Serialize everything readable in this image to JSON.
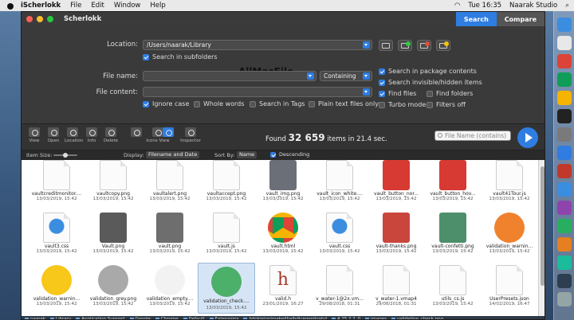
{
  "menubar": {
    "app": "iScherlokk",
    "menus": [
      "File",
      "Edit",
      "Window",
      "Help"
    ],
    "time": "Tue 16:35",
    "user": "Naarak Studio"
  },
  "window": {
    "title": "Scherlokk",
    "search_label": "Search",
    "compare_label": "Compare"
  },
  "form": {
    "location_label": "Location:",
    "location_value": "/Users/naarak/Library",
    "search_subfolders": "Search in subfolders",
    "filename_label": "File name:",
    "filename_mode": "Containing",
    "content_label": "File content:",
    "options": [
      {
        "label": "Ignore case",
        "checked": true
      },
      {
        "label": "Whole words",
        "checked": false
      },
      {
        "label": "Search in Tags",
        "checked": false
      },
      {
        "label": "Plain text files only",
        "checked": false
      }
    ],
    "right_options": [
      {
        "label": "Search in package contents",
        "checked": true
      },
      {
        "label": "Search invisible/hidden items",
        "checked": true
      },
      {
        "label": "Find files",
        "checked": true
      },
      {
        "label": "Find folders",
        "checked": false
      },
      {
        "label": "Turbo mode",
        "checked": false
      },
      {
        "label": "Filters off",
        "checked": false
      }
    ],
    "badges": [
      "1",
      "2",
      "3"
    ],
    "watermark": "AllMacFile"
  },
  "toolbar": {
    "tools": [
      "View",
      "Open",
      "Location",
      "Info",
      "Delete"
    ],
    "view_tools": [
      "Icons View",
      "Inspector"
    ],
    "found_prefix": "Found",
    "found_count": "32 659",
    "found_suffix": "items in 21.4 sec.",
    "filename_placeholder": "File Name (contains)"
  },
  "subbar": {
    "item_size": "Item Size:",
    "display_label": "Display:",
    "display_value": "Filename and Date",
    "sortby_label": "Sort By:",
    "sortby_value": "Name",
    "descending": "Descending"
  },
  "rows": [
    [
      {
        "name": "vaultcreditmonitor....",
        "date": "13/03/2019, 15:42",
        "kind": "doc",
        "color": "#ffffff"
      },
      {
        "name": "vaultcopy.png",
        "date": "13/03/2019, 15:42",
        "kind": "doc",
        "color": "#ffffff"
      },
      {
        "name": "vaultalert.png",
        "date": "13/03/2019, 15:42",
        "kind": "doc",
        "color": "#ffffff"
      },
      {
        "name": "vaultaccept.png",
        "date": "13/03/2019, 15:42",
        "kind": "doc",
        "color": "#ffffff"
      },
      {
        "name": "vault_img.png",
        "date": "13/03/2019, 15:42",
        "kind": "img",
        "color": "#6a6f78"
      },
      {
        "name": "vault_icon_white....",
        "date": "13/03/2019, 15:42",
        "kind": "doc",
        "color": "#ffffff"
      },
      {
        "name": "vault_button_nor...",
        "date": "13/03/2019, 15:42",
        "kind": "img",
        "color": "#d63a33"
      },
      {
        "name": "vault_button_hov...",
        "date": "13/03/2019, 15:42",
        "kind": "img",
        "color": "#d63a33"
      },
      {
        "name": "vault41Tour.js",
        "date": "13/03/2019, 15:42",
        "kind": "doc",
        "color": "#ffffff"
      }
    ],
    [
      {
        "name": "vault3.css",
        "date": "13/03/2019, 15:42",
        "kind": "css",
        "color": "#3b8de0"
      },
      {
        "name": "Vault.png",
        "date": "13/03/2019, 15:42",
        "kind": "img",
        "color": "#5a5a5a"
      },
      {
        "name": "vault.png",
        "date": "13/03/2019, 15:42",
        "kind": "img",
        "color": "#6e6e6e"
      },
      {
        "name": "vault.js",
        "date": "13/03/2019, 15:42",
        "kind": "doc",
        "color": "#ffffff"
      },
      {
        "name": "vault.html",
        "date": "13/03/2019, 15:42",
        "kind": "chrome",
        "color": "#4285f4"
      },
      {
        "name": "vault.css",
        "date": "13/03/2019, 15:42",
        "kind": "css",
        "color": "#3b8de0"
      },
      {
        "name": "vault-thanks.png",
        "date": "13/03/2019, 15:42",
        "kind": "img",
        "color": "#c9463d"
      },
      {
        "name": "vault-confetti.png",
        "date": "13/03/2019, 15:42",
        "kind": "img",
        "color": "#4d8f6a"
      },
      {
        "name": "validation_warnin...",
        "date": "13/03/2019, 15:42",
        "kind": "circle",
        "color": "#f0822e"
      }
    ],
    [
      {
        "name": "validation_warnin...",
        "date": "13/03/2019, 15:42",
        "kind": "circle",
        "color": "#f7c719"
      },
      {
        "name": "validation_grey.png",
        "date": "13/03/2019, 15:42",
        "kind": "circle",
        "color": "#a9a9a9"
      },
      {
        "name": "validation_empty....",
        "date": "13/03/2019, 15:42",
        "kind": "circle",
        "color": "#f2f2f2"
      },
      {
        "name": "validation_check....",
        "date": "13/03/2019, 15:42",
        "kind": "circle",
        "color": "#4caf6a",
        "selected": true
      },
      {
        "name": "valid.h",
        "date": "23/01/2019, 16:27",
        "kind": "h",
        "color": "#a33a2a"
      },
      {
        "name": "v_water-1@2x.vm...",
        "date": "29/08/2018, 01:31",
        "kind": "doc",
        "color": "#ffffff"
      },
      {
        "name": "v_water-1.vmap4",
        "date": "29/08/2018, 01:31",
        "kind": "doc",
        "color": "#ffffff"
      },
      {
        "name": "utils_cs.js",
        "date": "13/03/2019, 15:42",
        "kind": "doc",
        "color": "#ffffff"
      },
      {
        "name": "UserPresets.json",
        "date": "14/02/2019, 16:47",
        "kind": "doc",
        "color": "#ffffff"
      }
    ]
  ],
  "pathbar": [
    "naarak",
    "Library",
    "Application Support",
    "Google",
    "Chrome",
    "Default",
    "Extensions",
    "hdokiejnpimakedhajhdlcegeplioahd",
    "4.25.2.2_0",
    "images",
    "validation_check.png"
  ],
  "dock_colors": [
    "#3b8de0",
    "#e8e8e8",
    "#db4437",
    "#0f9d58",
    "#f4b400",
    "#222222",
    "#7a7a7a",
    "#2f7de1",
    "#c0392b",
    "#3b8de0",
    "#8e44ad",
    "#27ae60",
    "#e67e22",
    "#1abc9c",
    "#2c3e50",
    "#95a5a6"
  ]
}
